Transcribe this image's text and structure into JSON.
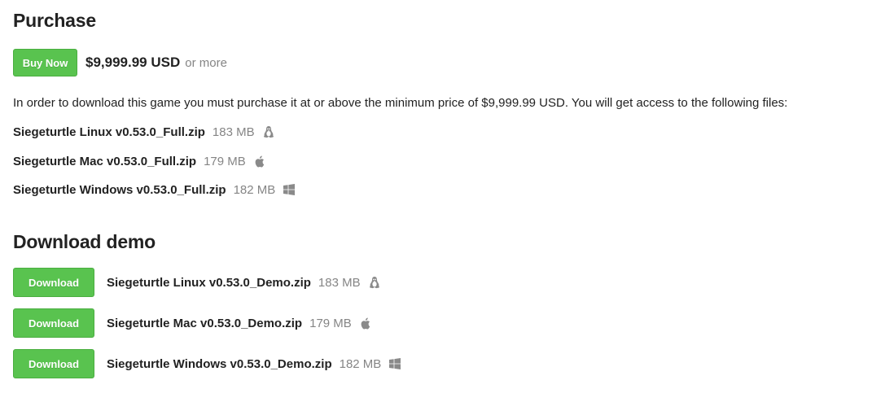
{
  "purchase": {
    "title": "Purchase",
    "buy_label": "Buy Now",
    "price": "$9,999.99 USD",
    "or_more": "or more",
    "notice": "In order to download this game you must purchase it at or above the minimum price of $9,999.99 USD. You will get access to the following files:",
    "files": [
      {
        "name": "Siegeturtle Linux v0.53.0_Full.zip",
        "size": "183 MB",
        "os_icon": "linux-icon"
      },
      {
        "name": "Siegeturtle Mac v0.53.0_Full.zip",
        "size": "179 MB",
        "os_icon": "apple-icon"
      },
      {
        "name": "Siegeturtle Windows v0.53.0_Full.zip",
        "size": "182 MB",
        "os_icon": "windows-icon"
      }
    ]
  },
  "demo": {
    "title": "Download demo",
    "files": [
      {
        "button_label": "Download",
        "name": "Siegeturtle Linux v0.53.0_Demo.zip",
        "size": "183 MB",
        "os_icon": "linux-icon"
      },
      {
        "button_label": "Download",
        "name": "Siegeturtle Mac v0.53.0_Demo.zip",
        "size": "179 MB",
        "os_icon": "apple-icon"
      },
      {
        "button_label": "Download",
        "name": "Siegeturtle Windows v0.53.0_Demo.zip",
        "size": "182 MB",
        "os_icon": "windows-icon"
      }
    ]
  },
  "colors": {
    "button_green": "#59c34f",
    "muted_text": "#858585",
    "body_text": "#222222"
  }
}
